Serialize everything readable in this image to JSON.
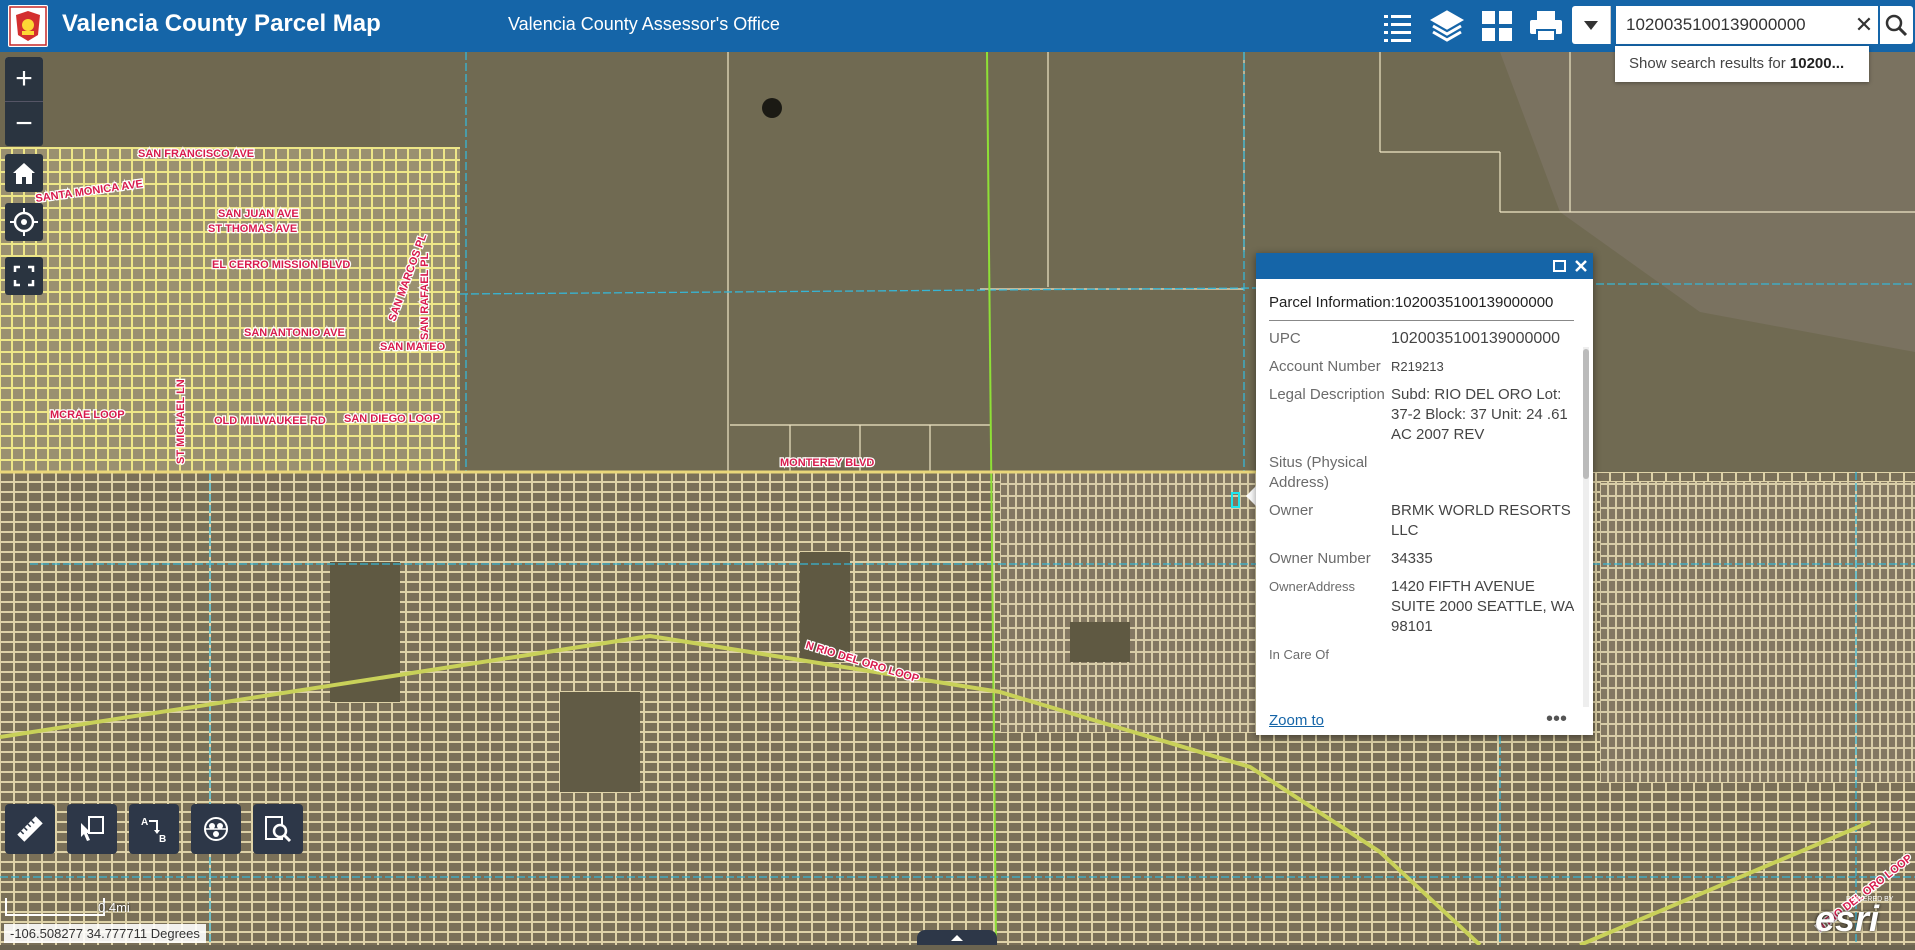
{
  "header": {
    "app_title": "Valencia County Parcel Map",
    "subtitle": "Valencia County Assessor's Office",
    "icons": [
      "legend-icon",
      "layers-icon",
      "basemap-gallery-icon",
      "print-icon"
    ],
    "brand_color": "#1565a8"
  },
  "search": {
    "value": "1020035100139000000",
    "suggestion_prefix": "Show search results for ",
    "suggestion_term": "10200..."
  },
  "map_labels": {
    "san_francisco": "SAN FRANCISCO AVE",
    "santa_monica": "SANTA MONICA AVE",
    "st_thomas": "ST THOMAS AVE",
    "san_juan": "SAN JUAN AVE",
    "el_cerro": "EL CERRO MISSION BLVD",
    "san_antonio": "SAN ANTONIO AVE",
    "san_mateo": "SAN MATEO",
    "san_marcos": "SAN MARCOS PL",
    "san_rafael": "SAN RAFAEL PL",
    "old_milwaukee": "OLD MILWAUKEE RD",
    "san_diego": "SAN DIEGO LOOP",
    "mcrae": "MCRAE LOOP",
    "st_michael": "ST MICHAEL LN",
    "monterey": "MONTEREY BLVD",
    "rio_del_oro": "N RIO DEL ORO LOOP",
    "rio_del_oro_2": "N RIO DEL ORO LOOP"
  },
  "popup": {
    "title": "Parcel Information:1020035100139000000",
    "fields": [
      {
        "label": "UPC",
        "value": "1020035100139000000"
      },
      {
        "label": "Account Number",
        "value": "R219213"
      },
      {
        "label": "Legal Description",
        "value": "Subd: RIO DEL ORO Lot: 37-2 Block: 37 Unit: 24 .61 AC 2007 REV"
      },
      {
        "label": "Situs (Physical Address)",
        "value": ""
      },
      {
        "label": "Owner",
        "value": "BRMK WORLD RESORTS LLC"
      },
      {
        "label": "Owner Number",
        "value": "34335"
      },
      {
        "label": "OwnerAddress",
        "value": "1420 FIFTH AVENUE SUITE 2000 SEATTLE, WA 98101"
      },
      {
        "label": "In Care Of",
        "value": ""
      }
    ],
    "zoom_label": "Zoom to",
    "more_label": "•••"
  },
  "scale": {
    "label": "0.4mi"
  },
  "coordinates": "-106.508277 34.777711 Degrees",
  "attribution": {
    "esri": "esri",
    "powered_by": "POWERED BY"
  }
}
